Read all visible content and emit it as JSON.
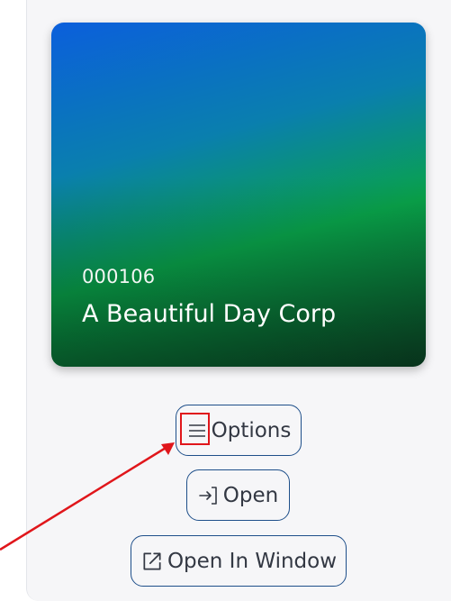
{
  "card": {
    "id": "000106",
    "name": "A Beautiful Day Corp"
  },
  "actions": {
    "options_label": "Options",
    "open_label": "Open",
    "open_window_label": "Open In Window"
  },
  "colors": {
    "button_border": "#1e4f8a",
    "annotation": "#e0161b"
  },
  "icons": {
    "options": "menu-icon",
    "open": "sign-in-icon",
    "open_window": "external-link-icon"
  }
}
